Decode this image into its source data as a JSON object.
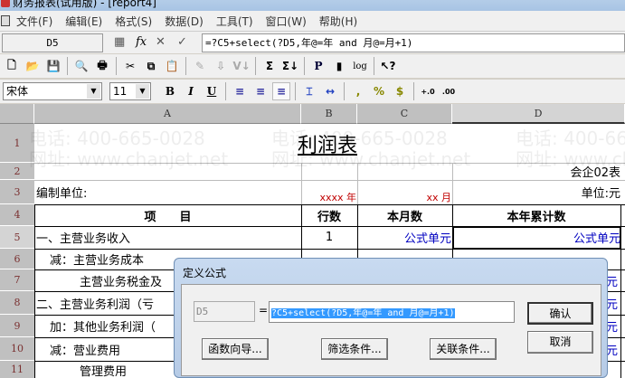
{
  "window": {
    "title": "财务报表(试用版) - [report4]"
  },
  "menu": [
    "文件(F)",
    "编辑(E)",
    "格式(S)",
    "数据(D)",
    "工具(T)",
    "窗口(W)",
    "帮助(H)"
  ],
  "formula_bar": {
    "cell_ref": "D5",
    "formula": "=?C5+select(?D5,年@=年 and 月@=月+1)"
  },
  "font": {
    "name": "宋体",
    "size": "11"
  },
  "watermark": {
    "phone": "电话: 400-665-0028",
    "site": "网址: www.chanjet.net"
  },
  "columns": [
    "A",
    "B",
    "C",
    "D"
  ],
  "rows": [
    "1",
    "2",
    "3",
    "4",
    "5",
    "6",
    "7",
    "8",
    "9",
    "10",
    "11"
  ],
  "sheet": {
    "title": "利润表",
    "form_no": "会企02表",
    "unit_label": "编制单位:",
    "year": "xxxx 年",
    "month": "xx 月",
    "currency": "单位:元",
    "headers": [
      "项　　目",
      "行数",
      "本月数",
      "本年累计数"
    ],
    "items": [
      "一、主营业务收入",
      "减：主营业务成本",
      "主营业务税金及",
      "二、主营业务利润（亏",
      "加：其他业务利润（",
      "减：营业费用",
      "管理费用"
    ],
    "row5_no": "1",
    "formula_cell": "公式单元",
    "partial": "元"
  },
  "dialog": {
    "title": "定义公式",
    "cell": "D5",
    "eq": "=",
    "formula": "?C5+select(?D5,年@=年 and 月@=月+1)",
    "ok": "确认",
    "cancel": "取消",
    "func_wizard": "函数向导...",
    "filter": "筛选条件...",
    "relation": "关联条件..."
  }
}
